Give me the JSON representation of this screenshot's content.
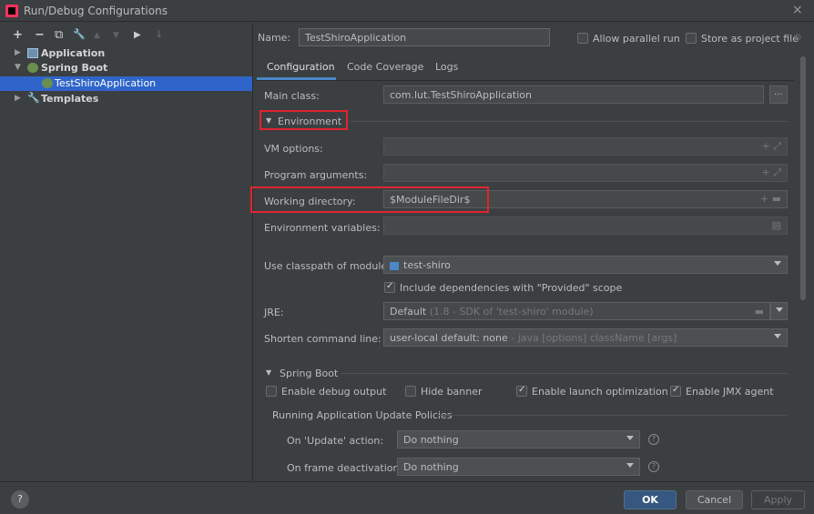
{
  "window": {
    "title": "Run/Debug Configurations",
    "close": "×"
  },
  "toolbar": {
    "add": "+",
    "remove": "−",
    "copy": "⧉",
    "settings": "🔧",
    "up": "▲",
    "down": "▼",
    "folder": "▶",
    "sort": "↓"
  },
  "tree": {
    "items": [
      {
        "label": "Application",
        "arrow": "▶"
      },
      {
        "label": "Spring Boot",
        "arrow": "▼"
      },
      {
        "label": "TestShiroApplication"
      },
      {
        "label": "Templates",
        "arrow": "▶"
      }
    ]
  },
  "header": {
    "name_label": "Name:",
    "name_value": "TestShiroApplication",
    "allow_parallel": "Allow parallel run",
    "store_project": "Store as project file"
  },
  "tabs": [
    "Configuration",
    "Code Coverage",
    "Logs"
  ],
  "config": {
    "main_class_label": "Main class:",
    "main_class_value": "com.lut.TestShiroApplication",
    "browse": "...",
    "environment_label": "Environment",
    "vm_options_label": "VM options:",
    "program_args_label": "Program arguments:",
    "working_dir_label": "Working directory:",
    "working_dir_value": "$ModuleFileDir$",
    "env_vars_label": "Environment variables:",
    "classpath_label": "Use classpath of module:",
    "classpath_value": "test-shiro",
    "include_provided": "Include dependencies with \"Provided\" scope",
    "jre_label": "JRE:",
    "jre_value": "Default",
    "jre_hint": "(1.8 - SDK of 'test-shiro' module)",
    "shorten_label": "Shorten command line:",
    "shorten_value": "user-local default: none",
    "shorten_hint": "- java [options] className [args]"
  },
  "spring_boot": {
    "section_label": "Spring Boot",
    "debug_output": "Enable debug output",
    "hide_banner": "Hide banner",
    "launch_opt": "Enable launch optimization",
    "jmx_agent": "Enable JMX agent",
    "policies_label": "Running Application Update Policies",
    "update_action_label": "On 'Update' action:",
    "update_action_value": "Do nothing",
    "frame_deact_label": "On frame deactivation:",
    "frame_deact_value": "Do nothing"
  },
  "buttons": {
    "help": "?",
    "ok": "OK",
    "cancel": "Cancel",
    "apply": "Apply"
  },
  "colors": {
    "accent": "#2f65ca",
    "highlight": "#e0242e",
    "ok": "#365880"
  }
}
